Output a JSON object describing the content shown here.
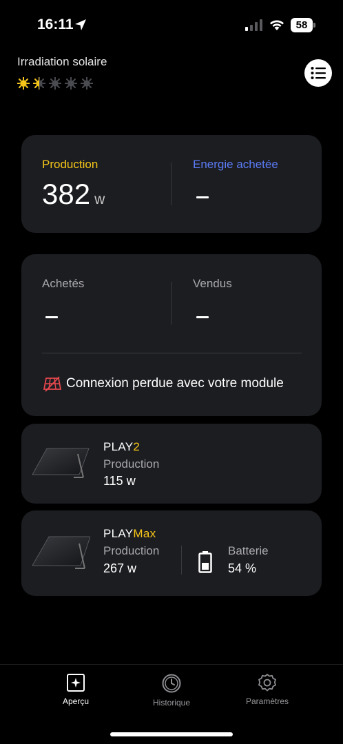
{
  "status_bar": {
    "time": "16:11",
    "battery": "58"
  },
  "header": {
    "title": "Irradiation solaire",
    "rating": 1.5,
    "rating_max": 5,
    "menu_icon": "list-icon"
  },
  "production_card": {
    "production_label": "Production",
    "production_value": "382",
    "production_unit": "w",
    "energy_label": "Energie achetée",
    "energy_value": "–"
  },
  "trade_card": {
    "bought_label": "Achetés",
    "bought_value": "–",
    "sold_label": "Vendus",
    "sold_value": "–",
    "connection_message": "Connexion perdue avec votre module",
    "connection_icon": "broken-panel-icon"
  },
  "devices": [
    {
      "name_prefix": "PLAY",
      "name_suffix": "2",
      "production_label": "Production",
      "production_value": "115 w"
    },
    {
      "name_prefix": "PLAY",
      "name_suffix": "Max",
      "production_label": "Production",
      "production_value": "267 w",
      "battery_label": "Batterie",
      "battery_value": "54 %"
    }
  ],
  "tabs": [
    {
      "label": "Aperçu",
      "icon": "overview-icon",
      "active": true
    },
    {
      "label": "Historique",
      "icon": "history-icon",
      "active": false
    },
    {
      "label": "Paramètres",
      "icon": "settings-icon",
      "active": false
    }
  ],
  "colors": {
    "accent_yellow": "#f5c518",
    "energy_blue": "#5b7cf6",
    "card_bg": "#1c1d21",
    "alert_red": "#e5484d"
  }
}
